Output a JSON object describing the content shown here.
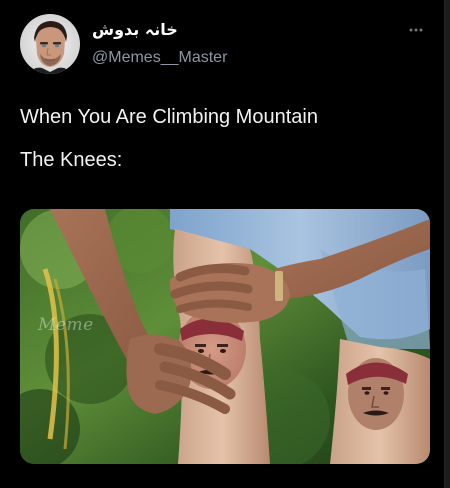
{
  "tweet": {
    "author": {
      "display_name": "خانہ بدوش",
      "handle": "@Memes__Master",
      "avatar_icon": "profile-photo"
    },
    "more_icon": "ellipsis-icon",
    "text_lines": [
      "When You Are Climbing Mountain",
      "The Knees:"
    ],
    "media": {
      "watermark": "Meme"
    }
  },
  "colors": {
    "background": "#000000",
    "text": "#e7e9ea",
    "secondary_text": "#8b98a5"
  }
}
